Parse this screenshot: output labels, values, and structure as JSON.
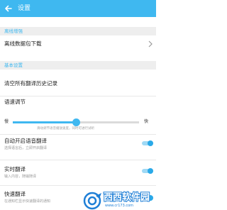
{
  "appbar": {
    "title": "设置",
    "back_icon": "arrow-left-icon",
    "background": "#3fb8f0"
  },
  "sections": {
    "offline": {
      "header": "离线增强",
      "download_label": "离线数据包下载"
    },
    "basic": {
      "header": "基本设置",
      "clear_history_label": "清空所有翻译历史记录",
      "speech_speed": {
        "label": "语速调节",
        "min_label": "慢",
        "max_label": "快",
        "note": "滑动调节语音播放速度，同时可进行试听",
        "value": 0.5
      },
      "auto_speak": {
        "title": "自动开启语音翻译",
        "subtitle": "选择语言后，立即开启翻译",
        "enabled": true
      },
      "realtime": {
        "title": "实时翻译",
        "subtitle": "输入内容，随输随译",
        "enabled": true
      },
      "quick_translate": {
        "title": "快速翻译",
        "subtitle": "在通知栏显示快速翻译的通知",
        "enabled": true
      }
    }
  },
  "watermark": {
    "text": "西西软件园",
    "url": "www.cr173.com"
  },
  "colors": {
    "accent": "#3fb8f0",
    "section_bg": "#eeeeee",
    "toggle_on": "#2aa9e8"
  }
}
